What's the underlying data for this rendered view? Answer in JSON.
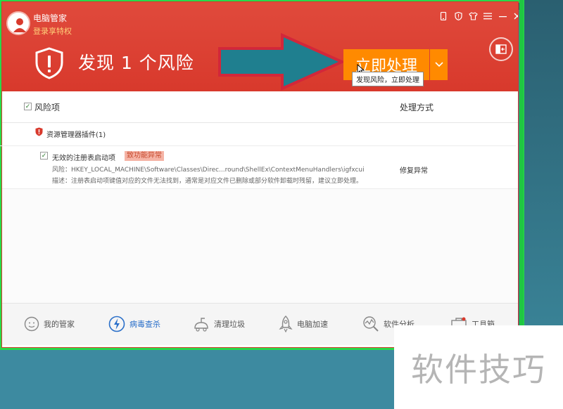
{
  "window": {
    "app_name": "电脑管家",
    "login_link": "登录享特权"
  },
  "header": {
    "risk_title": "发现 1 个风险",
    "action_button": "立即处理",
    "tooltip": "发现风险，立即处理"
  },
  "list": {
    "column_risk": "风险项",
    "column_action": "处理方式",
    "group": {
      "label": "资源管理器插件(1)"
    },
    "items": [
      {
        "title": "无效的注册表启动项",
        "badge": "致功能异常",
        "risk_line": "风险：HKEY_LOCAL_MACHINE\\Software\\Classes\\Direc...round\\ShellEx\\ContextMenuHandlers\\igfxcui",
        "desc_line": "描述：注册表启动项键值对应的文件无法找到，通常是对应文件已删除或部分软件卸载时残留，建议立即处理。",
        "action": "修复异常"
      }
    ]
  },
  "bottom_nav": [
    {
      "label": "我的管家",
      "icon": "face-icon"
    },
    {
      "label": "病毒查杀",
      "icon": "virus-scan-icon",
      "active": true
    },
    {
      "label": "清理垃圾",
      "icon": "vacuum-icon"
    },
    {
      "label": "电脑加速",
      "icon": "rocket-icon"
    },
    {
      "label": "软件分析",
      "icon": "analysis-icon"
    },
    {
      "label": "工具箱",
      "icon": "toolbox-icon"
    }
  ],
  "watermark": "软件技巧",
  "colors": {
    "header_red": "#d8392c",
    "action_orange": "#ff8a00",
    "active_blue": "#2a6fc9",
    "frame_green": "#29d94a"
  }
}
